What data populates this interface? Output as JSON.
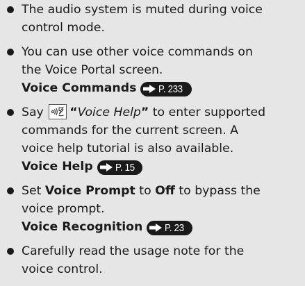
{
  "notes": [
    {
      "lines": [
        "The audio system is muted during voice",
        "control mode."
      ]
    },
    {
      "lines": [
        "You can use other voice commands on",
        "the Voice Portal screen."
      ],
      "ref": {
        "label": "Voice Commands",
        "page": "P. 233"
      }
    },
    {
      "say_prefix": "Say",
      "icon": "voice-talk-button-icon",
      "quote_open": "“",
      "command": "Voice Help",
      "quote_close": "”",
      "after_command": " to enter supported",
      "lines": [
        "commands for the current screen. A",
        "voice help tutorial is also available."
      ],
      "ref": {
        "label": "Voice Help",
        "page": "P. 15"
      }
    },
    {
      "set_prefix": "Set",
      "setting": "Voice Prompt",
      "to_word": "to",
      "value": "Off",
      "after_value": "to bypass the",
      "lines": [
        "voice prompt."
      ],
      "ref": {
        "label": "Voice Recognition",
        "page": "P. 23"
      }
    },
    {
      "lines": [
        "Carefully read the usage note for the",
        "voice control."
      ]
    }
  ],
  "colors": {
    "background": "#e6e6e6",
    "text": "#1a1a1a",
    "chip_background": "#1a1a1a",
    "chip_text": "#ffffff"
  }
}
